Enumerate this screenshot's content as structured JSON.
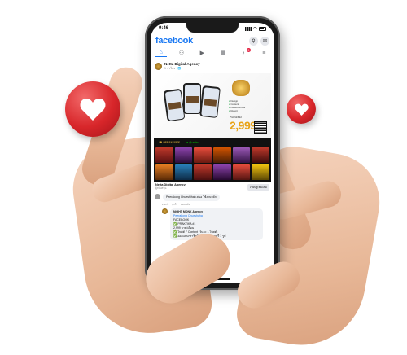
{
  "status_bar": {
    "time": "9:46"
  },
  "app": {
    "logo": "facebook",
    "search_icon": "search-icon",
    "messenger_icon": "messenger-icon"
  },
  "nav": {
    "items": [
      {
        "icon": "home-icon",
        "glyph": "⌂"
      },
      {
        "icon": "friends-icon",
        "glyph": "👥"
      },
      {
        "icon": "watch-icon",
        "glyph": "▶"
      },
      {
        "icon": "marketplace-icon",
        "glyph": "▦"
      },
      {
        "icon": "notifications-icon",
        "glyph": "🔔",
        "badge": "9"
      },
      {
        "icon": "menu-icon",
        "glyph": "≡"
      }
    ]
  },
  "post": {
    "page_name": "Netta Digital Agency",
    "meta": "1 ชั่วโมง · 🌐",
    "price": "2,999",
    "price_unit": ".-/เดือน",
    "price_label": "เริ่มต้นเพียง",
    "features": [
      "Design",
      "Content",
      "Facebook Ads",
      "Report"
    ],
    "contact_phone": "☎ 083-9199322",
    "contact_line": "● @netta"
  },
  "ad_footer": {
    "name": "Netta Digital Agency",
    "sub": "ผู้สนับสนุน",
    "button": "เรียนรู้เพิ่มเติม"
  },
  "comment": {
    "text": "Peerakong Chueshihai เสนอ ใช้งานหลัก",
    "meta": [
      "2 นาที",
      "ถูกใจ",
      "ตอบกลับ"
    ]
  },
  "reply": {
    "author": "NIGHT MONK Agency",
    "mention": "Peerakong Chueshaha",
    "lines": [
      "FACEBOOK",
      "✅ PRAKTIKA #1",
      "2,999 บาท/เดือน",
      "✅ โพสต์ 7 Content (วันละ 1 โพสต์)",
      "✅ ออกแบบกราฟิกโฆษณาชิ้นแรกฟรี 1 รูป"
    ]
  },
  "colors": {
    "facebook_blue": "#1877f2",
    "heart_red": "#d8262a",
    "price_gold": "#e8a317"
  }
}
